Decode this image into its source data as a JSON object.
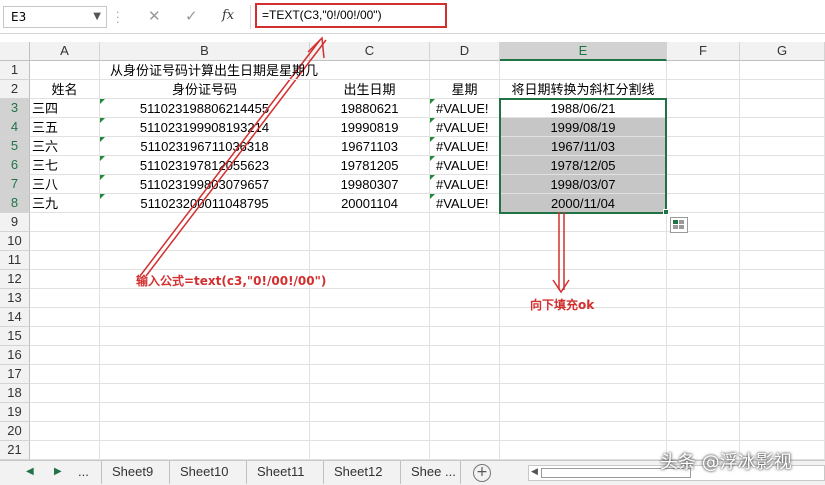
{
  "namebox": {
    "value": "E3"
  },
  "formula": {
    "text": "=TEXT(C3,\"0!/00!/00\")",
    "fx_label": "fx"
  },
  "columns": [
    "A",
    "B",
    "C",
    "D",
    "E",
    "F",
    "G"
  ],
  "rows": [
    "1",
    "2",
    "3",
    "4",
    "5",
    "6",
    "7",
    "8",
    "9",
    "10",
    "11",
    "12",
    "13",
    "14",
    "15",
    "16",
    "17",
    "18",
    "19",
    "20",
    "21"
  ],
  "title": "从身份证号码计算出生日期是星期几",
  "headers": {
    "name": "姓名",
    "id": "身份证号码",
    "birth": "出生日期",
    "weekday": "星期",
    "converted": "将日期转换为斜杠分割线"
  },
  "records": [
    {
      "name": "三四",
      "id": "511023198806214455",
      "birth": "19880621",
      "weekday": "#VALUE!",
      "converted": "1988/06/21"
    },
    {
      "name": "三五",
      "id": "511023199908193214",
      "birth": "19990819",
      "weekday": "#VALUE!",
      "converted": "1999/08/19"
    },
    {
      "name": "三六",
      "id": "511023196711036318",
      "birth": "19671103",
      "weekday": "#VALUE!",
      "converted": "1967/11/03"
    },
    {
      "name": "三七",
      "id": "511023197812055623",
      "birth": "19781205",
      "weekday": "#VALUE!",
      "converted": "1978/12/05"
    },
    {
      "name": "三八",
      "id": "511023199803079657",
      "birth": "19980307",
      "weekday": "#VALUE!",
      "converted": "1998/03/07"
    },
    {
      "name": "三九",
      "id": "511023200011048795",
      "birth": "20001104",
      "weekday": "#VALUE!",
      "converted": "2000/11/04"
    }
  ],
  "annotations": {
    "formula_note": "输入公式=text(c3,\"0!/00!/00\")",
    "fill_note": "向下填充ok"
  },
  "tabs": {
    "more_left": "...",
    "sheets": [
      "Sheet9",
      "Sheet10",
      "Sheet11",
      "Sheet12",
      "Shee ..."
    ]
  },
  "watermark": "头条 @浮冰影视",
  "colors": {
    "accent": "#217346",
    "annotation": "#d32f2f",
    "selection": "#c6c6c6",
    "error_indicator": "#1e8a3a"
  }
}
